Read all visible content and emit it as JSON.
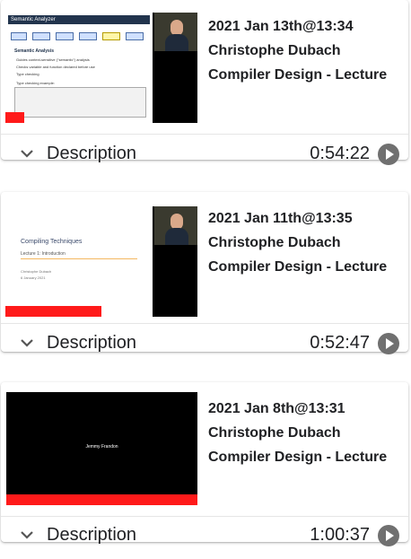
{
  "videos": [
    {
      "date": "2021 Jan 13th@13:34",
      "presenter": "Christophe Dubach",
      "title": "Compiler Design - Lecture",
      "description_label": "Description",
      "duration": "0:54:22",
      "progress_fraction": 0.1,
      "thumbnail": {
        "slide_heading": "Semantic Analyzer",
        "section": "Semantic Analysis",
        "bullets": [
          "Guides context-sensitive (\"semantic\") analysis",
          "Checks variable and function declared before use",
          "Type checking"
        ],
        "extra": "Type checking example:"
      }
    },
    {
      "date": "2021 Jan 11th@13:35",
      "presenter": "Christophe Dubach",
      "title": "Compiler Design - Lecture",
      "description_label": "Description",
      "duration": "0:52:47",
      "progress_fraction": 0.5,
      "thumbnail": {
        "slide_title": "Compiling Techniques",
        "slide_subtitle": "Lecture 1: Introduction",
        "slide_author": "Christophe Dubach",
        "slide_date": "6 January 2021"
      }
    },
    {
      "date": "2021 Jan 8th@13:31",
      "presenter": "Christophe Dubach",
      "title": "Compiler Design - Lecture",
      "description_label": "Description",
      "duration": "1:00:37",
      "progress_fraction": 1.0,
      "thumbnail": {
        "caption": "Jemmy Frandon"
      }
    }
  ],
  "icons": {
    "expand": "chevron-down-icon",
    "play": "play-circle-icon"
  },
  "colors": {
    "progress": "#ff1a1a",
    "play": "#707070"
  }
}
